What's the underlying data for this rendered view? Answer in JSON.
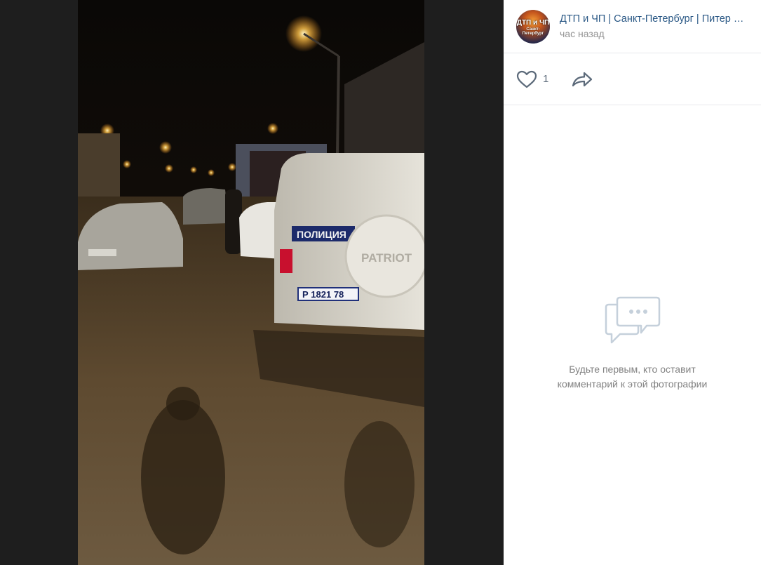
{
  "post": {
    "group_name": "ДТП и ЧП | Санкт-Петербург | Питер Онлайн | СПб",
    "time": "час назад",
    "avatar_line1": "ДТП и ЧП",
    "avatar_line2": "Санкт-Петербург"
  },
  "actions": {
    "like_count": "1",
    "like_icon": "heart-icon",
    "share_icon": "share-arrow-icon"
  },
  "comments": {
    "empty_line1": "Будьте первым, кто оставит",
    "empty_line2": "комментарий к этой фотографии",
    "icon": "chat-bubbles-icon"
  },
  "photo": {
    "plate_text": "Р 1821 78",
    "police_label": "ПОЛИЦИЯ",
    "spare_wheel_text": "PATRIOT"
  },
  "colors": {
    "link": "#2a5885",
    "muted": "#939393",
    "icon": "#5c6a7a",
    "empty_icon": "#c5d0db"
  }
}
